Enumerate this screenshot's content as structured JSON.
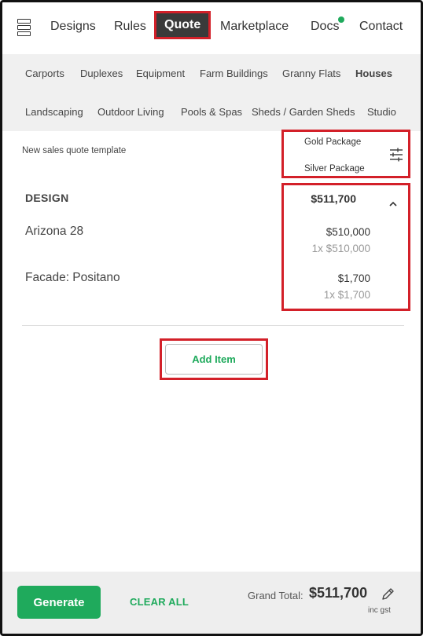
{
  "nav": {
    "items": [
      {
        "label": "Designs"
      },
      {
        "label": "Rules"
      },
      {
        "label": "Quote"
      },
      {
        "label": "Marketplace"
      },
      {
        "label": "Docs"
      },
      {
        "label": "Contact"
      }
    ],
    "active": "Quote",
    "docs_badge_color": "#1faa5c"
  },
  "categories": {
    "row1": [
      "Carports",
      "Duplexes",
      "Equipment",
      "Farm Buildings",
      "Granny Flats",
      "Houses"
    ],
    "row2": [
      "Landscaping",
      "Outdoor Living",
      "Pools & Spas",
      "Sheds / Garden Sheds",
      "Studio"
    ],
    "selected": "Houses"
  },
  "quote": {
    "template_label": "New sales quote template",
    "packages": [
      "Gold Package",
      "Silver Package"
    ],
    "section": {
      "title": "DESIGN",
      "total": "$511,700",
      "items": [
        {
          "name": "Arizona 28",
          "price": "$510,000",
          "unit_line": "1x $510,000"
        },
        {
          "name": "Facade: Positano",
          "price": "$1,700",
          "unit_line": "1x $1,700"
        }
      ]
    },
    "add_item_label": "Add Item"
  },
  "footer": {
    "generate_label": "Generate",
    "clear_label": "CLEAR ALL",
    "grand_total_label": "Grand Total:",
    "grand_total_value": "$511,700",
    "tax_note": "inc gst"
  },
  "colors": {
    "accent": "#1faa5c",
    "highlight": "#d32029",
    "active_tab_bg": "#3a3a3a"
  }
}
